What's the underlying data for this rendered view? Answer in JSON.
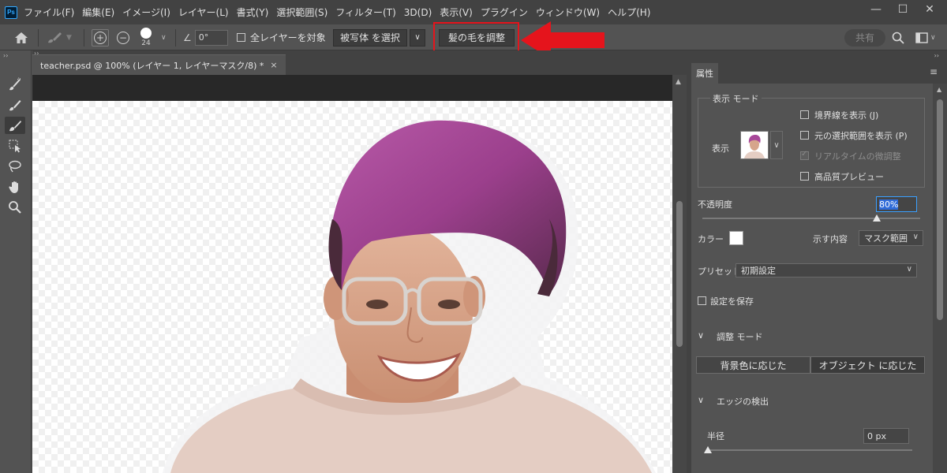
{
  "menu": {
    "logo": "Ps",
    "items": [
      "ファイル(F)",
      "編集(E)",
      "イメージ(I)",
      "レイヤー(L)",
      "書式(Y)",
      "選択範囲(S)",
      "フィルター(T)",
      "3D(D)",
      "表示(V)",
      "プラグイン",
      "ウィンドウ(W)",
      "ヘルプ(H)"
    ]
  },
  "window_controls": {
    "minimize": "—",
    "maximize": "☐",
    "close": "✕"
  },
  "options": {
    "brush_size": "24",
    "angle_value": "0°",
    "sample_all_layers": "全レイヤーを対象",
    "select_subject": "被写体 を選択",
    "refine_hair": "髪の毛を調整",
    "share": "共有"
  },
  "document": {
    "tab_title": "teacher.psd @ 100% (レイヤー 1, レイヤーマスク/8) *",
    "close": "×"
  },
  "properties": {
    "tab": "属性",
    "view_mode": {
      "title": "表示 モード",
      "view_label": "表示",
      "show_edge": "境界線を表示 (J)",
      "show_original": "元の選択範囲を表示 (P)",
      "realtime_refine": "リアルタイムの微調整",
      "high_quality": "高品質プレビュー"
    },
    "opacity": {
      "label": "不透明度",
      "value": "80%",
      "percent": 80
    },
    "color": {
      "label": "カラー",
      "value": "#ffffff"
    },
    "indicates": {
      "label": "示す内容",
      "value": "マスク範囲"
    },
    "preset": {
      "label": "プリセット",
      "value": "初期設定"
    },
    "save_settings": "設定を保存",
    "refine_mode": {
      "title": "調整 モード",
      "color_aware": "背景色に応じた",
      "object_aware": "オブジェクト に応じた"
    },
    "edge_detection": {
      "title": "エッジの検出",
      "radius_label": "半径",
      "radius_value": "0 px"
    }
  },
  "colors": {
    "highlight": "#e5141c",
    "accent": "#31a8ff"
  }
}
